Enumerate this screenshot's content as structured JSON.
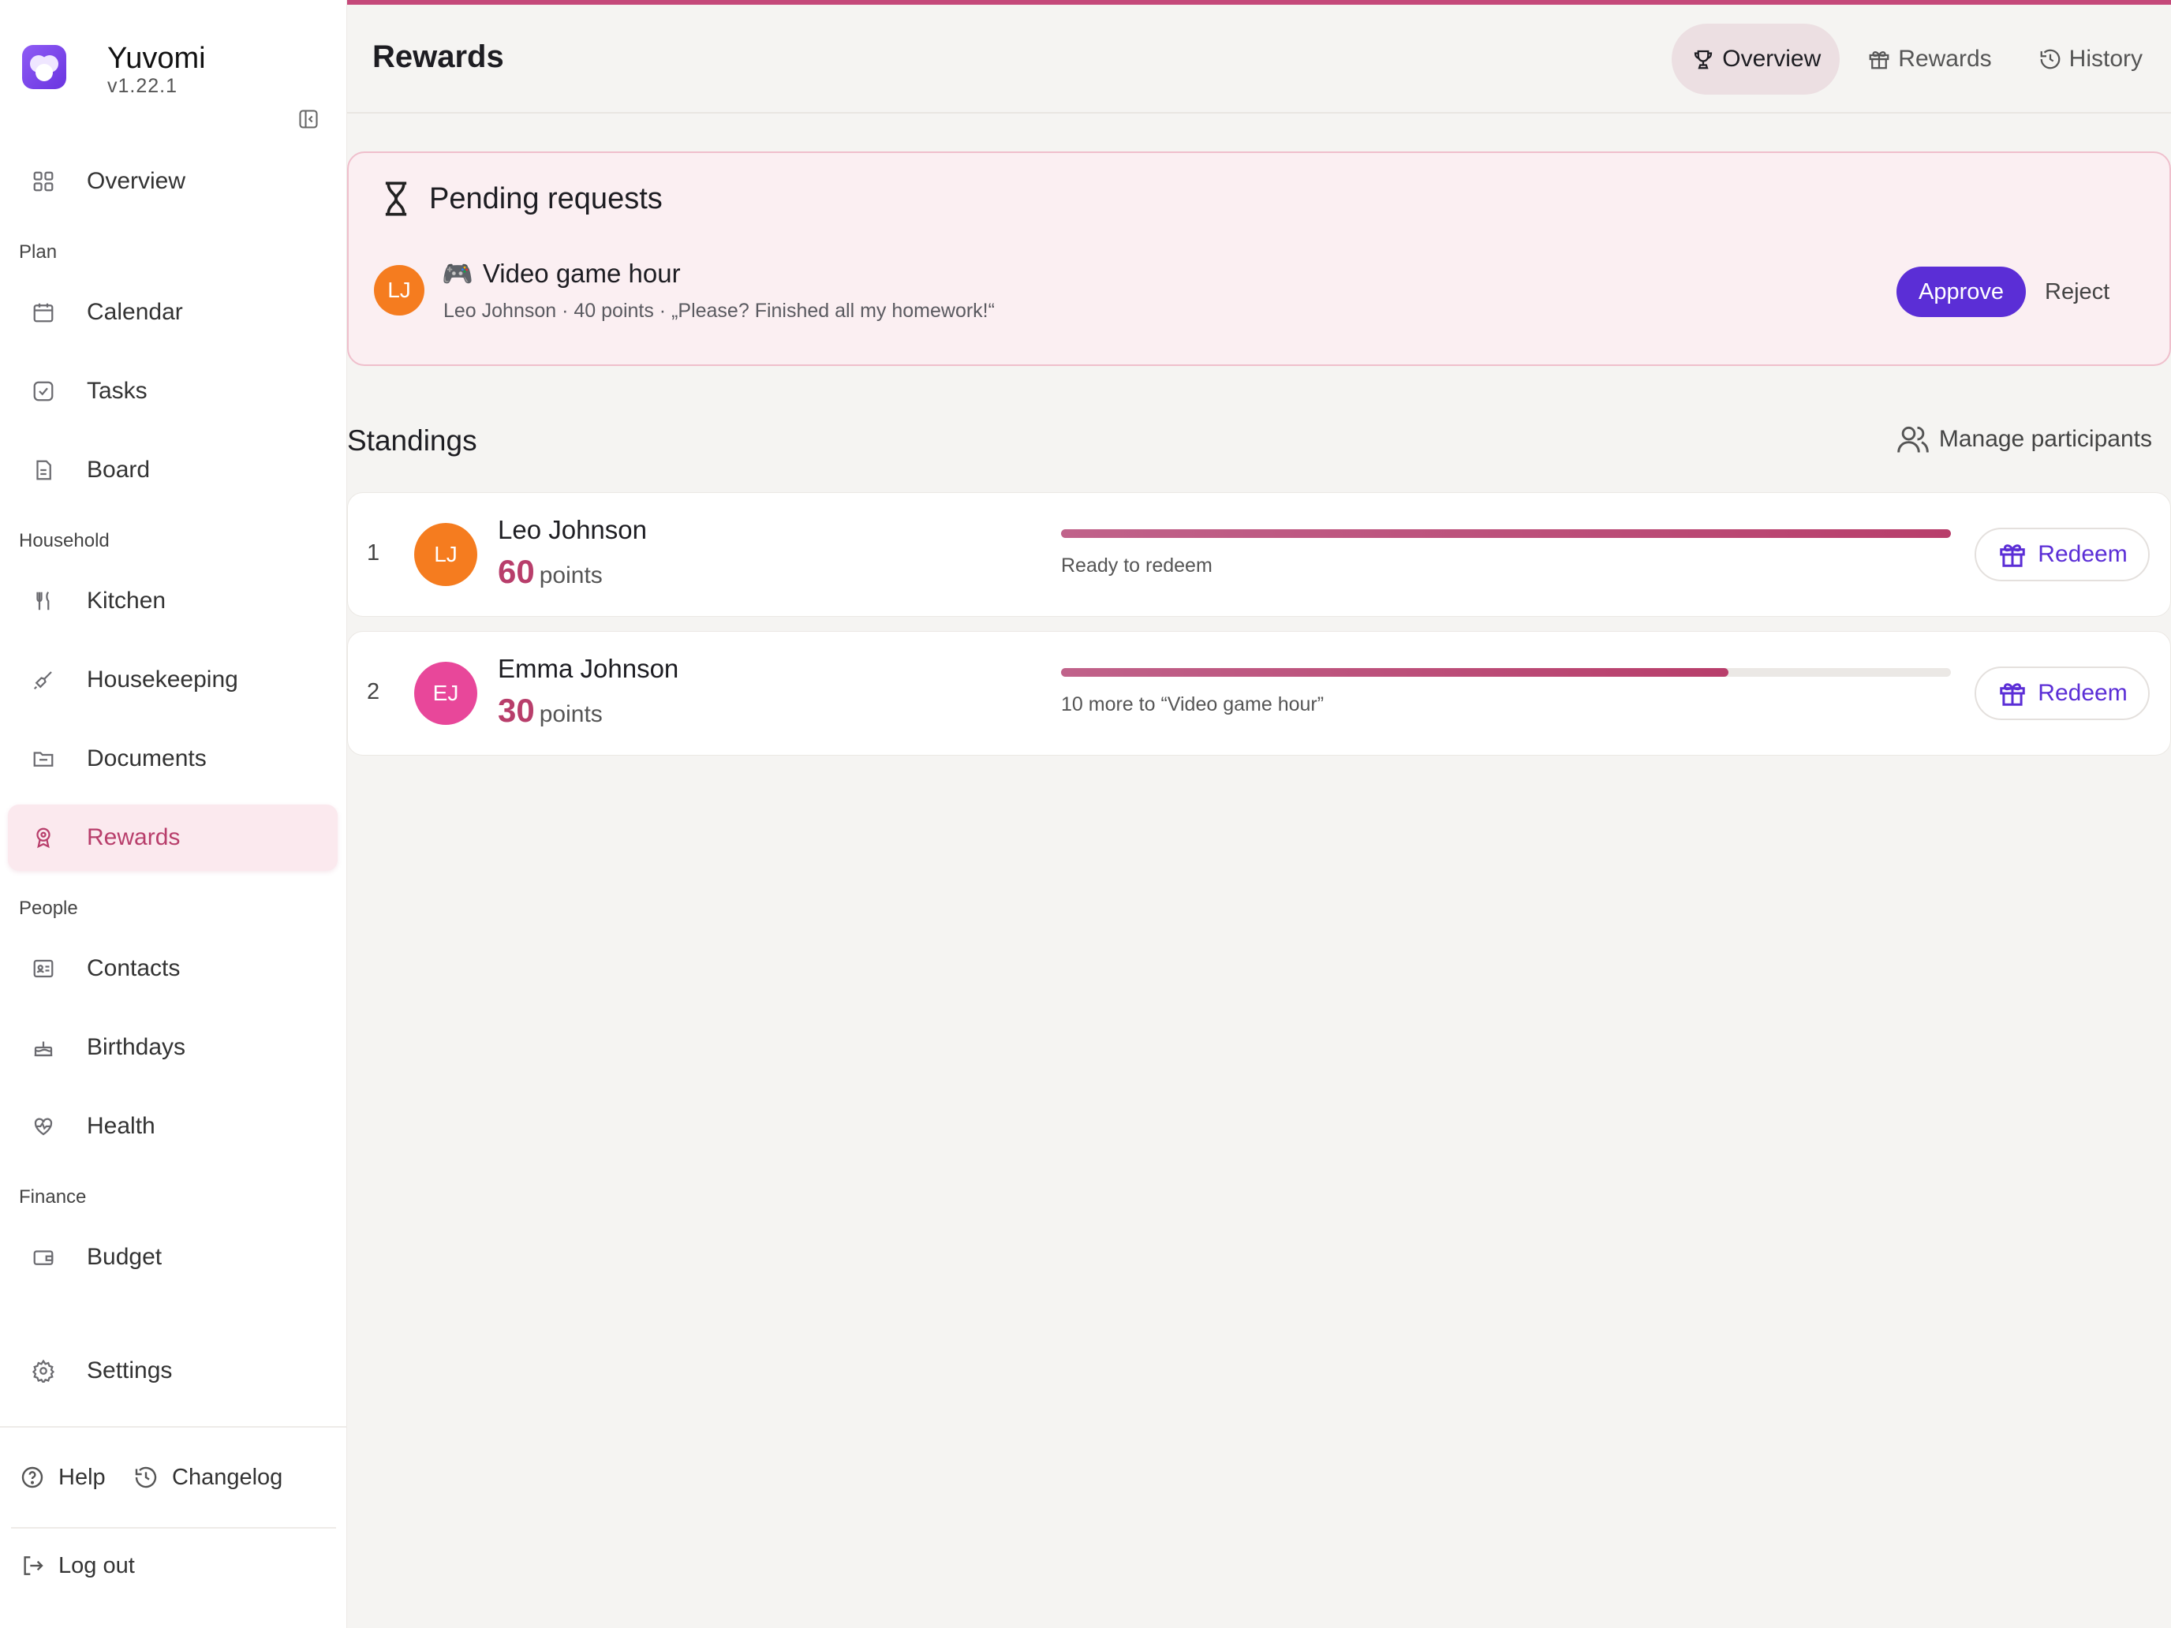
{
  "app": {
    "name": "Yuvomi",
    "version": "v1.22.1"
  },
  "sidebar": {
    "overview": "Overview",
    "sections": {
      "plan": "Plan",
      "household": "Household",
      "people": "People",
      "finance": "Finance"
    },
    "items": {
      "calendar": "Calendar",
      "tasks": "Tasks",
      "board": "Board",
      "kitchen": "Kitchen",
      "housekeeping": "Housekeeping",
      "documents": "Documents",
      "rewards": "Rewards",
      "contacts": "Contacts",
      "birthdays": "Birthdays",
      "health": "Health",
      "budget": "Budget",
      "settings": "Settings"
    },
    "active": "rewards",
    "footer": {
      "help": "Help",
      "changelog": "Changelog",
      "logout": "Log out"
    }
  },
  "header": {
    "title": "Rewards",
    "tabs": [
      {
        "label": "Overview",
        "icon": "trophy-icon",
        "active": true
      },
      {
        "label": "Rewards",
        "icon": "gift-icon",
        "active": false
      },
      {
        "label": "History",
        "icon": "history-icon",
        "active": false
      }
    ]
  },
  "pending": {
    "title": "Pending requests",
    "requests": [
      {
        "initials": "LJ",
        "emoji": "🎮",
        "reward": "Video game hour",
        "details": "Leo Johnson · 40 points · „Please? Finished all my homework!“",
        "approve_label": "Approve",
        "reject_label": "Reject"
      }
    ]
  },
  "standings": {
    "title": "Standings",
    "manage_label": "Manage participants",
    "points_unit": "points",
    "redeem_label": "Redeem",
    "rows": [
      {
        "rank": "1",
        "initials": "LJ",
        "name": "Leo Johnson",
        "points": "60",
        "progress": 1.0,
        "caption": "Ready to redeem",
        "avatar_color": "#f57c1f"
      },
      {
        "rank": "2",
        "initials": "EJ",
        "name": "Emma Johnson",
        "points": "30",
        "progress": 0.75,
        "caption": "10 more to “Video game hour”",
        "avatar_color": "#e8479a"
      }
    ]
  },
  "colors": {
    "accent": "#b83e6b",
    "primary": "#5b2ed6",
    "pending_bg": "#fbeff2"
  }
}
